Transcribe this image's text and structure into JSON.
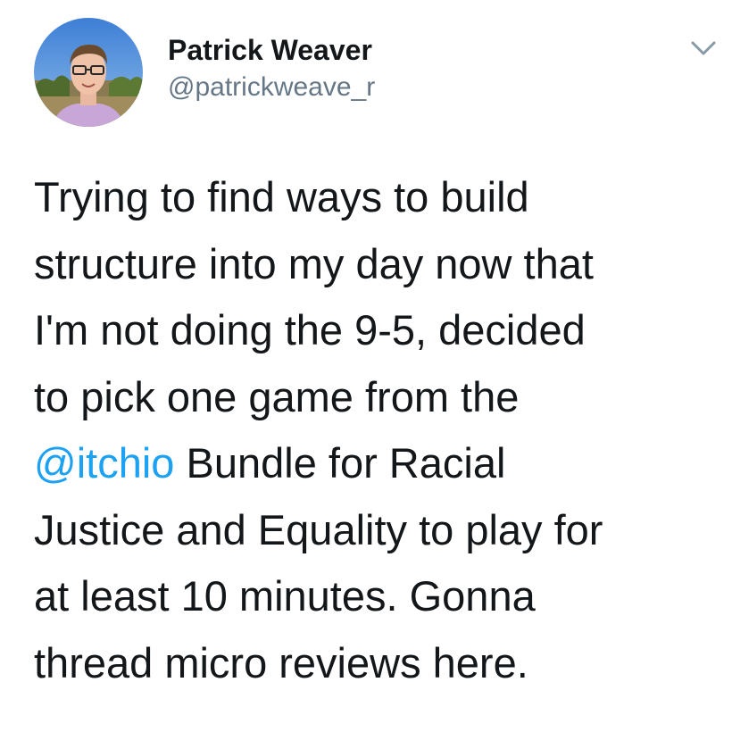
{
  "author": {
    "display_name": "Patrick Weaver",
    "handle": "@patrickweave_r"
  },
  "menu": {
    "icon": "chevron-down-icon"
  },
  "tweet": {
    "lines": [
      "Trying to find ways to build",
      "structure into my day now that",
      "I'm not doing the 9-5, decided",
      "to pick one game from the",
      {
        "mention": "@itchio",
        "rest": " Bundle for Racial"
      },
      "Justice and Equality to play for",
      "at least 10 minutes. Gonna",
      "thread micro reviews here."
    ]
  },
  "colors": {
    "text": "#14171a",
    "secondary": "#657786",
    "mention": "#1da1f2",
    "background": "#ffffff"
  }
}
